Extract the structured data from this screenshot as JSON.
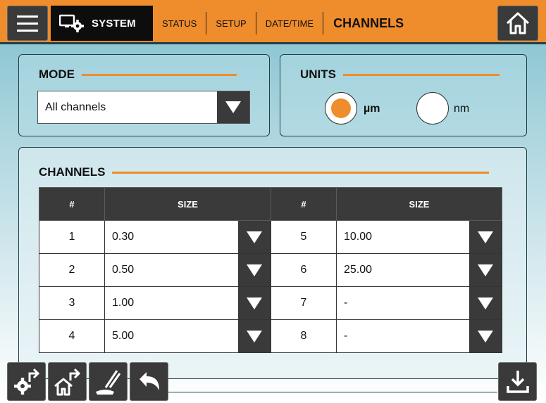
{
  "header": {
    "system_label": "SYSTEM",
    "tabs": [
      {
        "label": "STATUS"
      },
      {
        "label": "SETUP"
      },
      {
        "label": "DATE/TIME"
      },
      {
        "label": "CHANNELS"
      }
    ],
    "active_tab": "CHANNELS"
  },
  "mode": {
    "title": "MODE",
    "selected": "All channels"
  },
  "units": {
    "title": "UNITS",
    "options": [
      {
        "label": "µm",
        "selected": true
      },
      {
        "label": "nm",
        "selected": false
      }
    ]
  },
  "channels": {
    "title": "CHANNELS",
    "columns": [
      "#",
      "SIZE",
      "#",
      "SIZE"
    ],
    "rows": [
      {
        "left_no": "1",
        "left_size": "0.30",
        "right_no": "5",
        "right_size": "10.00"
      },
      {
        "left_no": "2",
        "left_size": "0.50",
        "right_no": "6",
        "right_size": "25.00"
      },
      {
        "left_no": "3",
        "left_size": "1.00",
        "right_no": "7",
        "right_size": "-"
      },
      {
        "left_no": "4",
        "left_size": "5.00",
        "right_no": "8",
        "right_size": "-"
      }
    ]
  },
  "icons": {
    "menu": "hamburger-menu-icon",
    "system": "system-settings-icon",
    "home": "home-icon",
    "bottom": [
      "settings-back-icon",
      "home-back-icon",
      "clean-icon",
      "undo-icon",
      "download-icon"
    ]
  },
  "colors": {
    "accent": "#ef8c2c",
    "dark": "#3a3a3a",
    "system_tab": "#0d0d0d"
  }
}
